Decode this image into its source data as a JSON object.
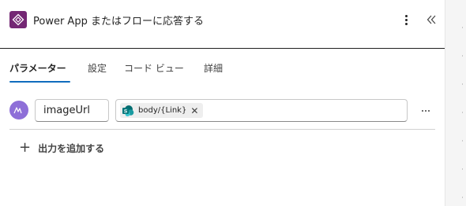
{
  "header": {
    "title": "Power App またはフローに応答する",
    "app_icon": "power-automate-diamond-icon",
    "more_icon": "more-vertical-icon",
    "collapse_icon": "chevron-double-left-icon"
  },
  "tabs": [
    {
      "label": "パラメーター",
      "active": true
    },
    {
      "label": "設定",
      "active": false
    },
    {
      "label": "コード ビュー",
      "active": false
    },
    {
      "label": "詳細",
      "active": false
    }
  ],
  "parameter": {
    "type_icon": "text-type-icon",
    "name": "imageUrl",
    "token": {
      "label": "body/{Link}",
      "icon": "sharepoint-icon",
      "remove_icon": "close-icon"
    },
    "more_icon": "more-horizontal-icon"
  },
  "add_output": {
    "label": "出力を追加する",
    "icon": "plus-icon"
  },
  "colors": {
    "app_tile": "#742774",
    "accent": "#0f6cbd",
    "avatar": "#8e6fd8"
  }
}
